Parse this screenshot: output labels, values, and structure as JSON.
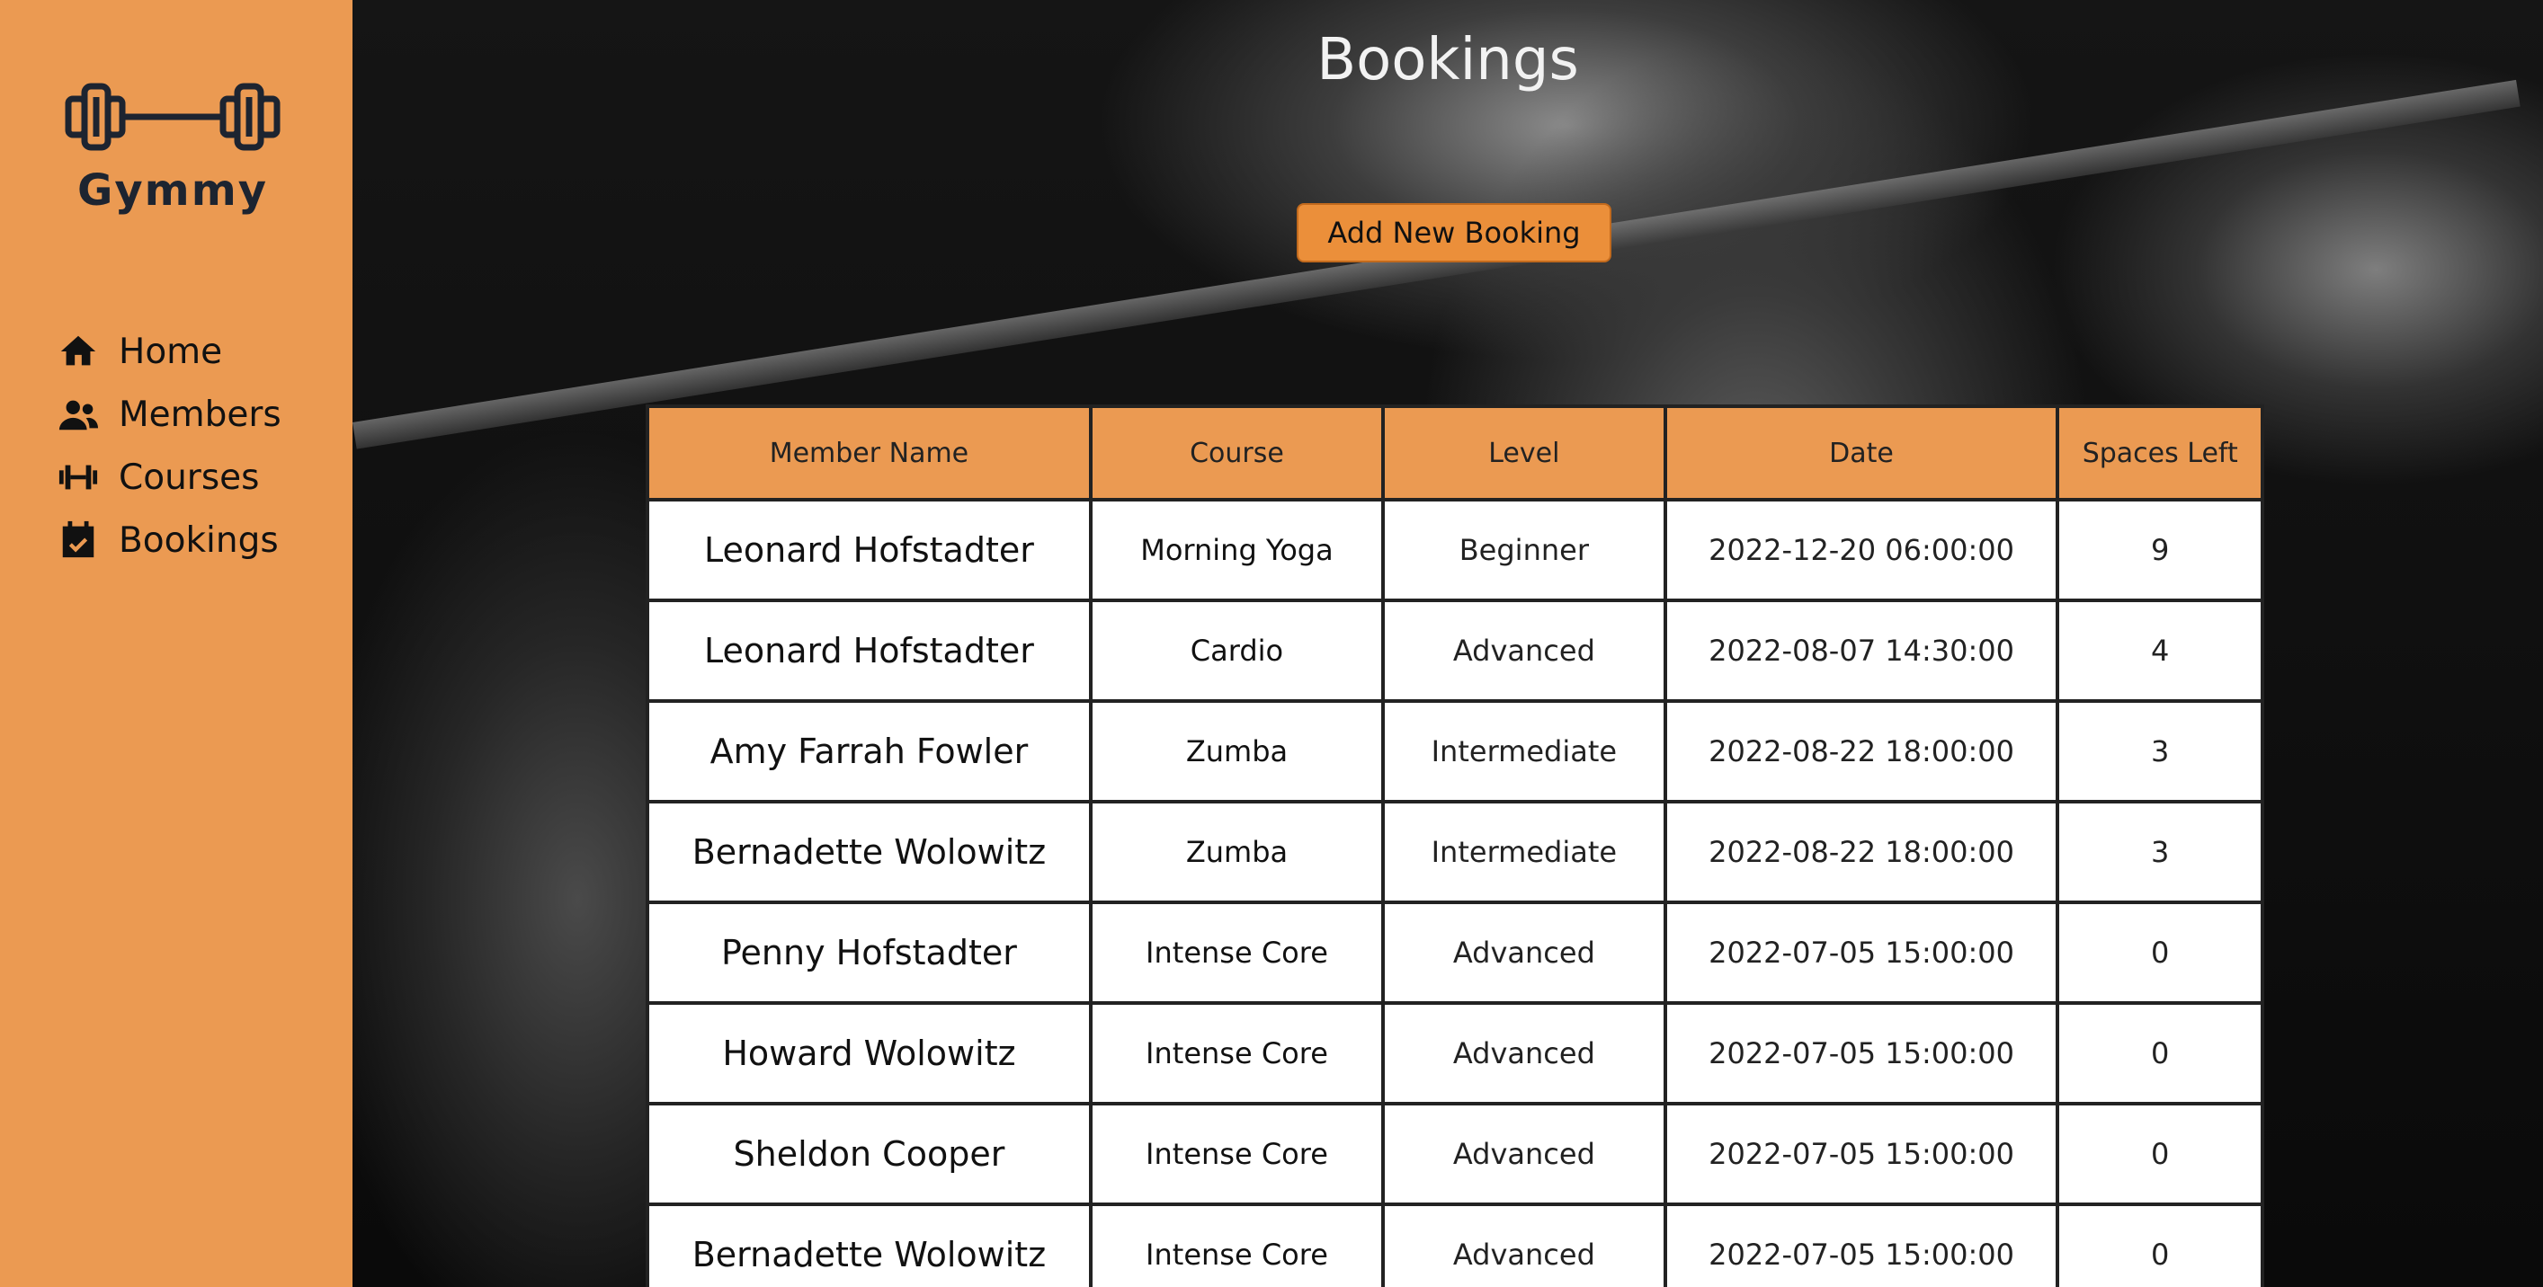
{
  "app": {
    "name": "Gymmy",
    "accent_color": "#eb9a52"
  },
  "sidebar": {
    "items": [
      {
        "label": "Home",
        "icon": "home-icon"
      },
      {
        "label": "Members",
        "icon": "users-icon"
      },
      {
        "label": "Courses",
        "icon": "dumbbell-icon"
      },
      {
        "label": "Bookings",
        "icon": "calendar-check-icon"
      }
    ]
  },
  "main": {
    "title": "Bookings",
    "add_button_label": "Add New Booking",
    "table": {
      "headers": [
        "Member Name",
        "Course",
        "Level",
        "Date",
        "Spaces Left"
      ],
      "rows": [
        [
          "Leonard Hofstadter",
          "Morning Yoga",
          "Beginner",
          "2022-12-20 06:00:00",
          "9"
        ],
        [
          "Leonard Hofstadter",
          "Cardio",
          "Advanced",
          "2022-08-07 14:30:00",
          "4"
        ],
        [
          "Amy Farrah Fowler",
          "Zumba",
          "Intermediate",
          "2022-08-22 18:00:00",
          "3"
        ],
        [
          "Bernadette Wolowitz",
          "Zumba",
          "Intermediate",
          "2022-08-22 18:00:00",
          "3"
        ],
        [
          "Penny Hofstadter",
          "Intense Core",
          "Advanced",
          "2022-07-05 15:00:00",
          "0"
        ],
        [
          "Howard Wolowitz",
          "Intense Core",
          "Advanced",
          "2022-07-05 15:00:00",
          "0"
        ],
        [
          "Sheldon Cooper",
          "Intense Core",
          "Advanced",
          "2022-07-05 15:00:00",
          "0"
        ],
        [
          "Bernadette Wolowitz",
          "Intense Core",
          "Advanced",
          "2022-07-05 15:00:00",
          "0"
        ]
      ]
    }
  }
}
